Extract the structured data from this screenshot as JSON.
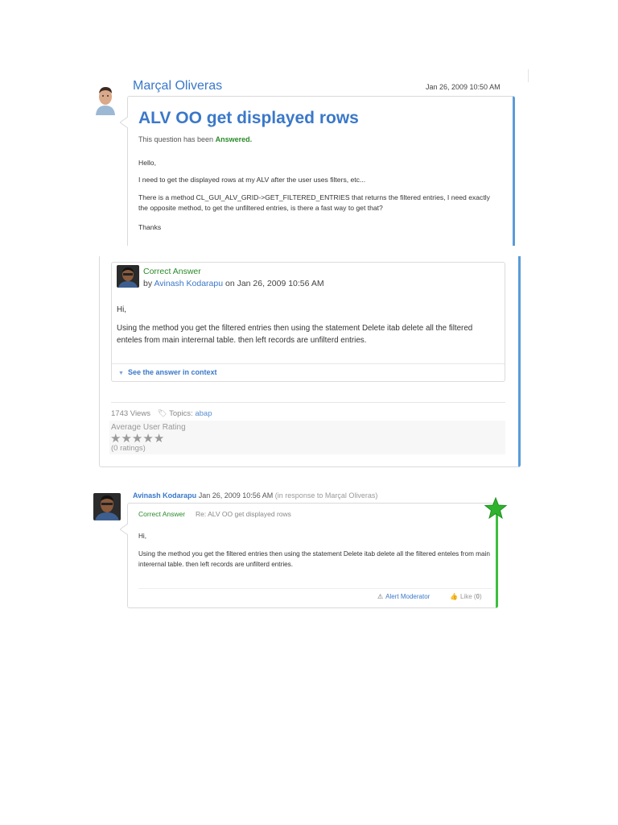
{
  "question": {
    "author": "Marçal Oliveras",
    "date": "Jan 26, 2009 10:50 AM",
    "title": "ALV OO get displayed rows",
    "status_prefix": "This question has been ",
    "status_value": "Answered.",
    "body": [
      "Hello,",
      "I need to get the displayed rows at my ALV after the user uses filters, etc...",
      "There is a method CL_GUI_ALV_GRID->GET_FILTERED_ENTRIES that returns the filtered entries, I need exactly the opposite method, to get the unfiltered entries, is there a fast way to get that?",
      "Thanks"
    ]
  },
  "answer": {
    "label": "Correct Answer",
    "by_prefix": "by ",
    "author": "Avinash Kodarapu",
    "date_text": " on Jan 26, 2009 10:56 AM",
    "greeting": "Hi,",
    "body": "Using the method you get the filtered entries then using the statement Delete itab delete all the filtered enteles from main interernal table. then left records are unfilterd entries.",
    "context_link": "See the answer in context"
  },
  "stats": {
    "views": "1743 Views",
    "topics_label": "Topics:",
    "topic": "abap",
    "rating_label": "Average User Rating",
    "ratings_count": "(0 ratings)",
    "stars_total": 5,
    "stars_filled": 0
  },
  "reply": {
    "author": "Avinash Kodarapu",
    "date": "Jan 26, 2009 10:56 AM",
    "in_response": "(in response to Marçal Oliveras)",
    "label": "Correct Answer",
    "subject": "Re: ALV OO get displayed rows",
    "greeting": "Hi,",
    "body": "Using the method you get the filtered entries then using the statement Delete itab delete all the filtered enteles from main interernal table. then left records are unfilterd entries.",
    "alert_label": "Alert Moderator",
    "like_label": "Like",
    "like_count": "0"
  },
  "colors": {
    "link_blue": "#3a78c9",
    "answered_green": "#2a8a2a",
    "question_border": "#5b9bd9",
    "reply_border": "#3bbf3b"
  }
}
